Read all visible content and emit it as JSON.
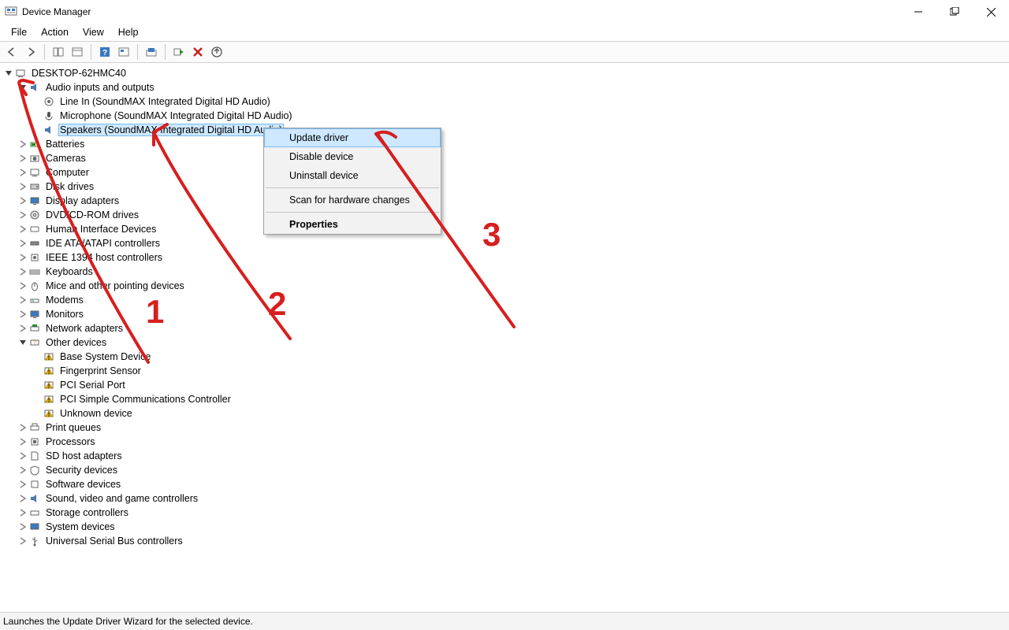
{
  "window": {
    "title": "Device Manager"
  },
  "menu": {
    "file": "File",
    "action": "Action",
    "view": "View",
    "help": "Help"
  },
  "tree": {
    "root": "DESKTOP-62HMC40",
    "audio": {
      "label": "Audio inputs and outputs",
      "line_in": "Line In (SoundMAX Integrated Digital HD Audio)",
      "microphone": "Microphone (SoundMAX Integrated Digital HD Audio)",
      "speakers": "Speakers (SoundMAX Integrated Digital HD Audio)"
    },
    "batteries": "Batteries",
    "cameras": "Cameras",
    "computer": "Computer",
    "disk": "Disk drives",
    "display": "Display adapters",
    "dvd": "DVD/CD-ROM drives",
    "hid": "Human Interface Devices",
    "ide": "IDE ATA/ATAPI controllers",
    "ieee": "IEEE 1394 host controllers",
    "keyboards": "Keyboards",
    "mice": "Mice and other pointing devices",
    "modems": "Modems",
    "monitors": "Monitors",
    "network": "Network adapters",
    "other": {
      "label": "Other devices",
      "base": "Base System Device",
      "fingerprint": "Fingerprint Sensor",
      "pci_serial": "PCI Serial Port",
      "pci_comm": "PCI Simple Communications Controller",
      "unknown": "Unknown device"
    },
    "print": "Print queues",
    "processors": "Processors",
    "sd": "SD host adapters",
    "security": "Security devices",
    "software": "Software devices",
    "sound": "Sound, video and game controllers",
    "storage": "Storage controllers",
    "system": "System devices",
    "usb": "Universal Serial Bus controllers"
  },
  "context_menu": {
    "update": "Update driver",
    "disable": "Disable device",
    "uninstall": "Uninstall device",
    "scan": "Scan for hardware changes",
    "properties": "Properties"
  },
  "status": "Launches the Update Driver Wizard for the selected device.",
  "annotations": {
    "a1": "1",
    "a2": "2",
    "a3": "3"
  }
}
